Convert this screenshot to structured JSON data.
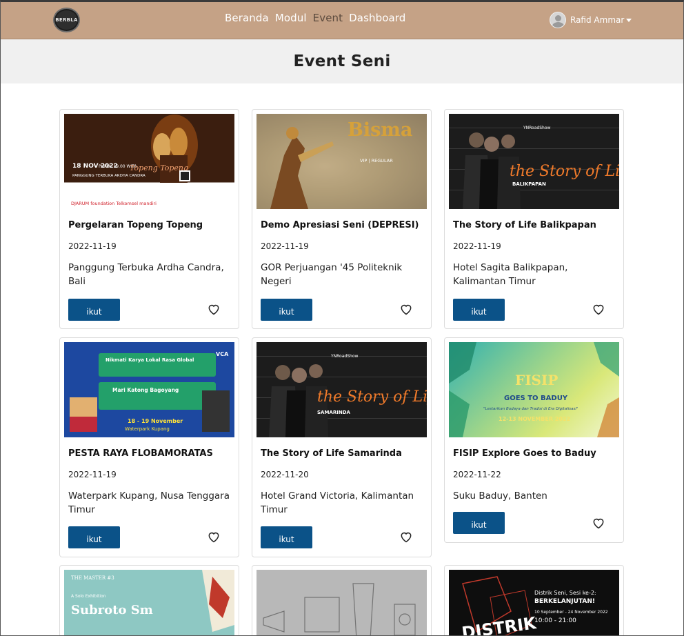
{
  "brand": {
    "logo_text": "BERBLA"
  },
  "nav": {
    "links": [
      "Beranda",
      "Modul",
      "Event",
      "Dashboard"
    ],
    "active": "Event",
    "user_name": "Rafid Ammar"
  },
  "page": {
    "title": "Event Seni"
  },
  "ui": {
    "join_label": "ikut"
  },
  "events": [
    {
      "title": "Pergelaran Topeng Topeng",
      "date": "2022-11-19",
      "location": "Panggung Terbuka Ardha Candra, Bali",
      "image": "topeng",
      "image_text": {
        "date": "18 NOV 2022",
        "time": "PUKUL 19.00 WITA",
        "venue": "PANGGUNG TERBUKA ARDHA CANDRA",
        "name": "Topeng Topeng",
        "sponsors": "DJARUM foundation  Telkomsel  mandiri"
      }
    },
    {
      "title": "Demo Apresiasi Seni (DEPRESI)",
      "date": "2022-11-19",
      "location": "GOR Perjuangan '45 Politeknik Negeri",
      "image": "bisma",
      "image_text": {
        "name": "Bisma",
        "sub": "VIP | REGULAR"
      }
    },
    {
      "title": "The Story of Life Balikpapan",
      "date": "2022-11-19",
      "location": "Hotel Sagita Balikpapan, Kalimantan Timur",
      "image": "story",
      "image_text": {
        "brand": "YNRoadShow",
        "name": "the Story of Life",
        "city": "BALIKPAPAN"
      }
    },
    {
      "title": "PESTA RAYA FLOBAMORATAS",
      "date": "2022-11-19",
      "location": "Waterpark Kupang, Nusa Tenggara Timur",
      "image": "flobo",
      "image_text": {
        "day1": "Nikmati Karya Lokal Rasa Global",
        "day2": "Mari Katong Bagoyang",
        "dates": "18 - 19 November",
        "venue": "Waterpark Kupang",
        "badge": "VCA"
      }
    },
    {
      "title": "The Story of Life Samarinda",
      "date": "2022-11-20",
      "location": "Hotel Grand Victoria, Kalimantan Timur",
      "image": "story",
      "image_text": {
        "brand": "YNRoadShow",
        "name": "the Story of Life",
        "city": "SAMARINDA"
      }
    },
    {
      "title": "FISIP Explore Goes to Baduy",
      "date": "2022-11-22",
      "location": "Suku Baduy, Banten",
      "image": "fisip",
      "image_text": {
        "name": "FISIP",
        "sub": "GOES TO BADUY",
        "tagline": "\"Lestarikan Budaya dan Tradisi di Era Digitalisasi\"",
        "dates": "12-13 NOVEMBER 2022"
      }
    },
    {
      "title": "",
      "date": "",
      "location": "",
      "image": "master",
      "image_text": {
        "top": "THE MASTER #3",
        "sub": "A Solo Exhibition",
        "name": "Subroto Sm"
      }
    },
    {
      "title": "",
      "date": "",
      "location": "",
      "image": "sketch",
      "image_text": {}
    },
    {
      "title": "",
      "date": "",
      "location": "",
      "image": "distrik",
      "image_text": {
        "line1": "Distrik Seni, Sesi ke-2:",
        "line2": "BERKELANJUTAN!",
        "line3": "10 September - 24 November 2022",
        "line4": "10:00 - 21:00",
        "name": "DISTRIK"
      }
    }
  ]
}
